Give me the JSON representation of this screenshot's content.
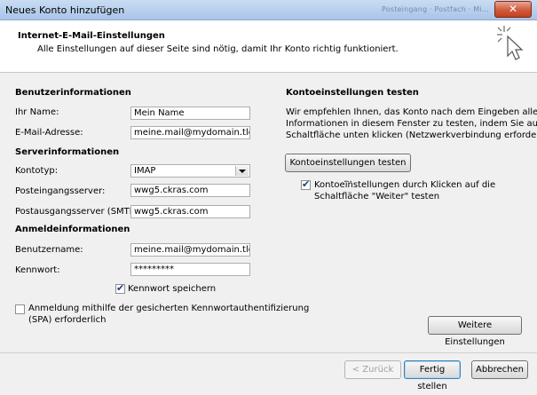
{
  "window": {
    "title": "Neues Konto hinzufügen",
    "faded_background_text": "Posteingang · Postfach · Mi..."
  },
  "header": {
    "title": "Internet-E-Mail-Einstellungen",
    "subtitle": "Alle Einstellungen auf dieser Seite sind nötig, damit Ihr Konto richtig funktioniert."
  },
  "benutzer": {
    "heading": "Benutzerinformationen",
    "name_label": "Ihr Name:",
    "name_value": "Mein Name",
    "email_label": "E-Mail-Adresse:",
    "email_value": "meine.mail@mydomain.tld"
  },
  "server": {
    "heading": "Serverinformationen",
    "kontotyp_label": "Kontotyp:",
    "kontotyp_value": "IMAP",
    "incoming_label": "Posteingangsserver:",
    "incoming_value": "wwg5.ckras.com",
    "outgoing_label": "Postausgangsserver (SMTP):",
    "outgoing_value": "wwg5.ckras.com"
  },
  "anmelde": {
    "heading": "Anmeldeinformationen",
    "user_label": "Benutzername:",
    "user_value": "meine.mail@mydomain.tld",
    "password_label": "Kennwort:",
    "password_value": "*********",
    "remember_label": "Kennwort speichern",
    "remember_checked": true,
    "spa_label_line1": "Anmeldung mithilfe der gesicherten Kennwortauthentifizierung",
    "spa_label_line2": "(SPA) erforderlich",
    "spa_checked": false
  },
  "test": {
    "heading": "Kontoeinstellungen testen",
    "desc_line1": "Wir empfehlen Ihnen, das Konto nach dem Eingeben aller",
    "desc_line2": "Informationen in diesem Fenster zu testen, indem Sie auf die",
    "desc_line3": "Schaltfläche unten klicken (Netzwerkverbindung erforderlich).",
    "button_label": "Kontoeinstellungen testen ...",
    "auto_label_line1": "Kontoeinstellungen durch Klicken auf die",
    "auto_label_line2": "Schaltfläche \"Weiter\" testen",
    "auto_checked": true
  },
  "buttons": {
    "more_settings": "Weitere Einstellungen",
    "back": "< Zurück",
    "finish": "Fertig stellen",
    "cancel": "Abbrechen"
  },
  "icons": {
    "close": "close-icon",
    "wizard": "cursor-sparkle-icon"
  }
}
